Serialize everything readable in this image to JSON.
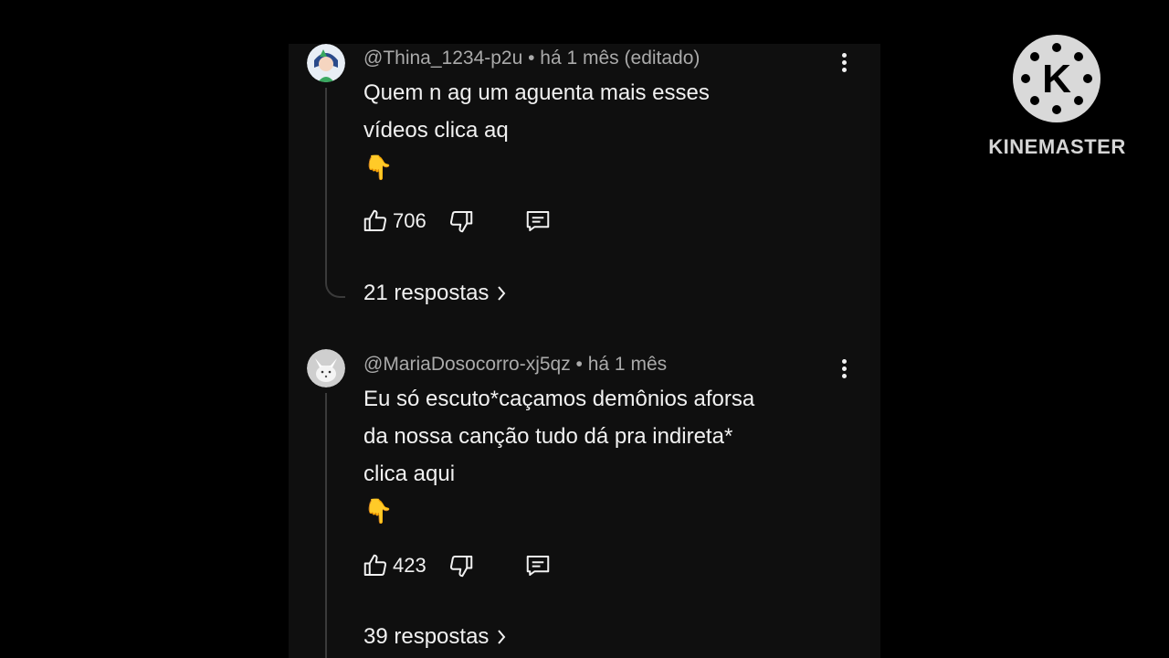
{
  "comments": [
    {
      "author": "@Thina_1234-p2u",
      "meta_suffix": " • há 1 mês (editado)",
      "text_line1": "Quem n ag um aguenta mais esses",
      "text_line2": "vídeos clica aq",
      "emoji": "👇",
      "likes": "706",
      "replies": "21 respostas",
      "avatar_icon": "anime-avatar"
    },
    {
      "author": "@MariaDosocorro-xj5qz",
      "meta_suffix": " • há 1 mês",
      "text_line1": "Eu só escuto*caçamos demônios aforsa",
      "text_line2": "da nossa canção tudo dá pra indireta*",
      "text_line3": "clica aqui",
      "emoji": "👇",
      "likes": "423",
      "replies": "39 respostas",
      "avatar_icon": "white-fox-avatar"
    }
  ],
  "watermark": {
    "logo_letter": "K",
    "text": "KINEMASTER"
  },
  "colors": {
    "background": "#000000",
    "panel": "#0f0f0f",
    "text": "#f1f1f1",
    "meta": "#aaaaaa",
    "thread_line": "#3a3a3a"
  },
  "icons": [
    "thumbs-up-icon",
    "thumbs-down-icon",
    "reply-icon",
    "more-options-icon",
    "chevron-right-icon"
  ]
}
